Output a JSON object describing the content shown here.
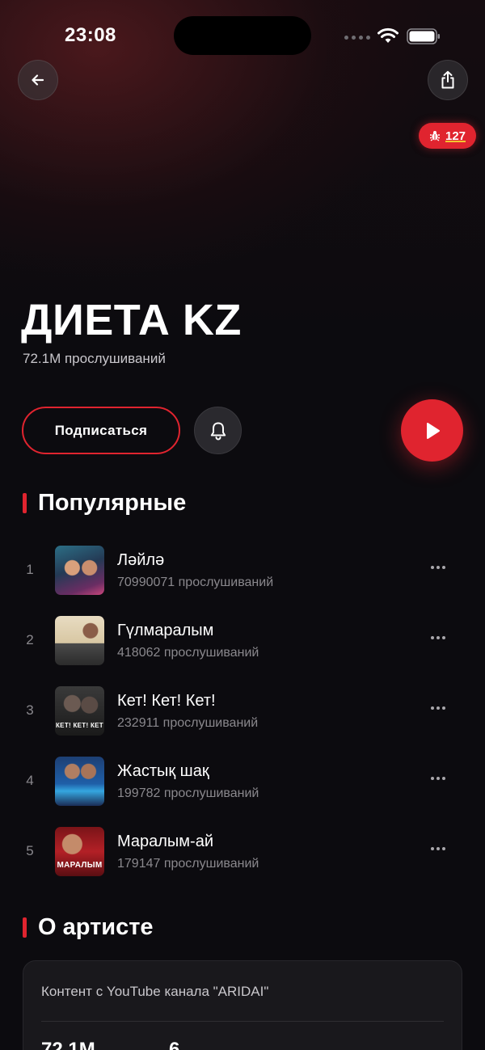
{
  "status_bar": {
    "time": "23:08"
  },
  "debug_badge": {
    "count": "127"
  },
  "artist": {
    "name": "ДИЕТА KZ",
    "listens": "72.1M прослушиваний"
  },
  "actions": {
    "subscribe_label": "Подписаться"
  },
  "popular": {
    "title": "Популярные",
    "tracks": [
      {
        "num": "1",
        "title": "Ләйлә",
        "plays": "70990071 прослушиваний",
        "cover_text": ""
      },
      {
        "num": "2",
        "title": "Гүлмаралым",
        "plays": "418062 прослушиваний",
        "cover_text": ""
      },
      {
        "num": "3",
        "title": "Кет! Кет! Кет!",
        "plays": "232911 прослушиваний",
        "cover_text": "КЕТ! КЕТ! КЕТ"
      },
      {
        "num": "4",
        "title": "Жастық шақ",
        "plays": "199782 прослушиваний",
        "cover_text": ""
      },
      {
        "num": "5",
        "title": "Маралым-ай",
        "plays": "179147 прослушиваний",
        "cover_text": "МАРАЛЫМ"
      }
    ]
  },
  "about": {
    "title": "О артисте",
    "source": "Контент с YouTube канала \"ARIDAI\"",
    "stat_1": "72.1M",
    "stat_2": "6"
  },
  "colors": {
    "accent": "#e0242f",
    "background": "#0c0b0f"
  }
}
